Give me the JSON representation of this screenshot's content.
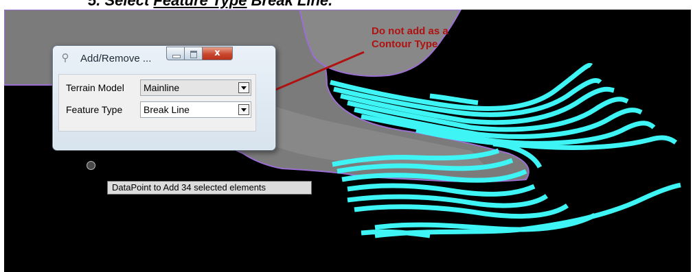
{
  "heading": {
    "step_number": "5.",
    "prefix": "Select ",
    "underlined": "Feature Type",
    "suffix": " Break Line."
  },
  "dialog": {
    "title": "Add/Remove ...",
    "close_label": "x",
    "fields": [
      {
        "label": "Terrain Model",
        "value": "Mainline"
      },
      {
        "label": "Feature Type",
        "value": "Break Line"
      }
    ]
  },
  "tooltip": {
    "text": "DataPoint to Add 34 selected elements"
  },
  "annotation": {
    "text": "Do not add as a\nContour Type",
    "color": "#b01212"
  },
  "colors": {
    "viewport_background": "#000000",
    "terrain_fill": "#7a7a7a",
    "terrain_outline": "#9b6fd2",
    "breaklines": "#3ff4f4",
    "arrow": "#b01212"
  }
}
